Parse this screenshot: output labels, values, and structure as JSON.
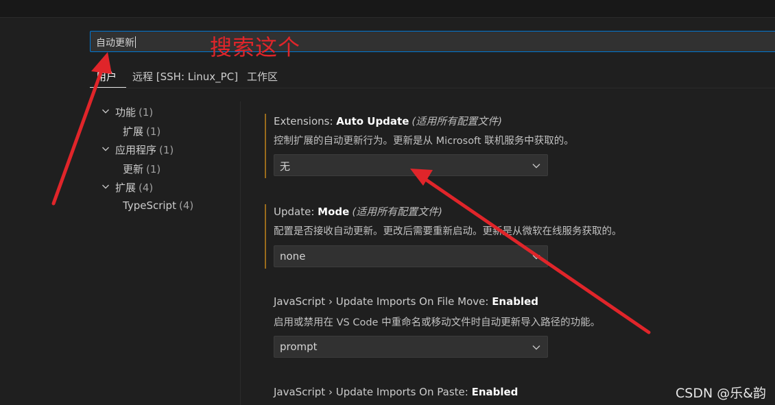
{
  "search": {
    "value": "自动更新"
  },
  "annotation": "搜索这个",
  "tabs": [
    {
      "label": "用户",
      "active": true
    },
    {
      "label": "远程 [SSH: Linux_PC]",
      "active": false
    },
    {
      "label": "工作区",
      "active": false
    }
  ],
  "toc": {
    "groups": [
      {
        "label": "功能",
        "count": "(1)",
        "children": [
          {
            "label": "扩展",
            "count": "(1)"
          }
        ]
      },
      {
        "label": "应用程序",
        "count": "(1)",
        "children": [
          {
            "label": "更新",
            "count": "(1)"
          }
        ]
      },
      {
        "label": "扩展",
        "count": "(4)",
        "children": [
          {
            "label": "TypeScript",
            "count": "(4)"
          }
        ]
      }
    ]
  },
  "settings": [
    {
      "category": "Extensions: ",
      "name": "Auto Update",
      "scope": "(适用所有配置文件)",
      "description": "控制扩展的自动更新行为。更新是从 Microsoft 联机服务中获取的。",
      "value": "无"
    },
    {
      "category": "Update: ",
      "name": "Mode",
      "scope": "(适用所有配置文件)",
      "description": "配置是否接收自动更新。更改后需要重新启动。更新是从微软在线服务获取的。",
      "value": "none"
    },
    {
      "category": "JavaScript › Update Imports On File Move: ",
      "name": "Enabled",
      "scope": "",
      "description": "启用或禁用在 VS Code 中重命名或移动文件时自动更新导入路径的功能。",
      "value": "prompt"
    },
    {
      "category": "JavaScript › Update Imports On Paste: ",
      "name": "Enabled",
      "scope": "",
      "description": "",
      "value": ""
    }
  ],
  "watermark": "CSDN @乐&韵",
  "colors": {
    "annotation": "#e0252a",
    "accent": "#0078d4",
    "modified_bar": "#9a6b1c",
    "background": "#1f1f1f"
  }
}
